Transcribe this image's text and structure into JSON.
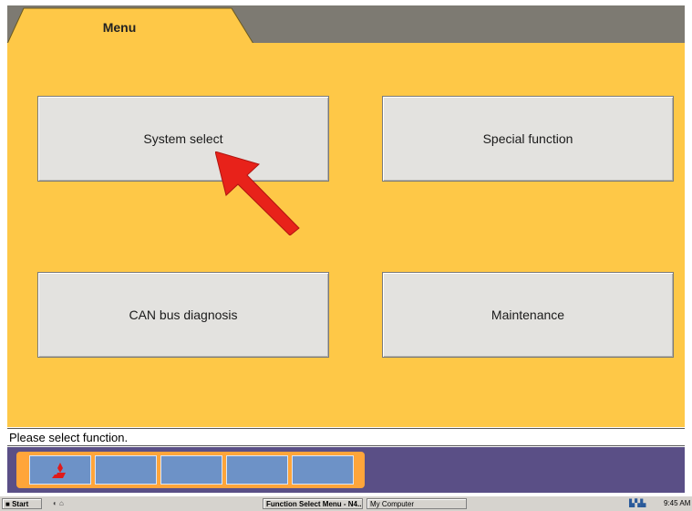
{
  "tab": {
    "title": "Menu"
  },
  "menu": {
    "system_select": "System select",
    "special_function": "Special function",
    "can_bus_diagnosis": "CAN bus diagnosis",
    "maintenance": "Maintenance"
  },
  "status": {
    "message": "Please select function."
  },
  "function_keys": {
    "count": 5,
    "first_icon": "mitsubishi-logo-icon"
  },
  "taskbar": {
    "start_label": "Start",
    "window1": "Function Select Menu - N4...",
    "window2": "My Computer",
    "clock": "9:45 AM"
  },
  "colors": {
    "background": "#fec847",
    "tab_bar": "#7d7a72",
    "button": "#e3e2df",
    "fkey_bar": "#5a4f86",
    "fkey_frame": "#ffa53a",
    "fkey": "#6d92c7",
    "pointer_arrow": "#e8221a"
  }
}
